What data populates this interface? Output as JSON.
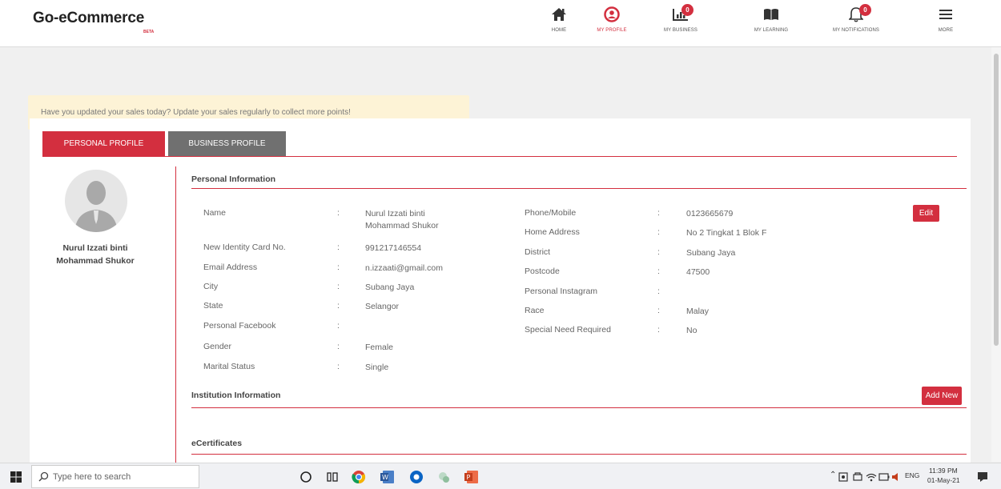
{
  "brand": {
    "title": "Go-eCommerce",
    "beta": "BETA"
  },
  "nav": [
    {
      "label": "HOME",
      "icon": "home-icon"
    },
    {
      "label": "MY PROFILE",
      "icon": "user-icon",
      "active": true
    },
    {
      "label": "MY BUSINESS",
      "icon": "chart-icon",
      "badge": "0"
    },
    {
      "label": "MY LEARNING",
      "icon": "book-icon"
    },
    {
      "label": "MY NOTIFICATIONS",
      "icon": "bell-icon",
      "badge": "0"
    },
    {
      "label": "MORE",
      "icon": "menu-icon"
    }
  ],
  "banner": "Have you updated your sales today? Update your sales regularly to collect more points!",
  "tabs": {
    "personal": "PERSONAL PROFILE",
    "business": "BUSINESS PROFILE"
  },
  "profile": {
    "name": "Nurul Izzati binti Mohammad Shukor"
  },
  "personal_info": {
    "title": "Personal Information",
    "left": [
      {
        "label": "Name",
        "value": "Nurul Izzati binti Mohammad Shukor"
      },
      {
        "label": "New Identity Card No.",
        "value": "991217146554"
      },
      {
        "label": "Email Address",
        "value": "n.izzaati@gmail.com"
      },
      {
        "label": "City",
        "value": "Subang Jaya"
      },
      {
        "label": "State",
        "value": "Selangor"
      },
      {
        "label": "Personal Facebook",
        "value": ""
      },
      {
        "label": "Gender",
        "value": "Female"
      },
      {
        "label": "Marital Status",
        "value": "Single"
      }
    ],
    "right": [
      {
        "label": "Phone/Mobile",
        "value": "0123665679"
      },
      {
        "label": "Home Address",
        "value": "No 2 Tingkat 1 Blok F"
      },
      {
        "label": "District",
        "value": "Subang Jaya"
      },
      {
        "label": "Postcode",
        "value": "47500"
      },
      {
        "label": "Personal Instagram",
        "value": ""
      },
      {
        "label": "Race",
        "value": "Malay"
      },
      {
        "label": "Special Need Required",
        "value": "No"
      }
    ],
    "separator": ":",
    "edit": "Edit"
  },
  "institution": {
    "title": "Institution Information",
    "add_new": "Add New"
  },
  "ecertificates": {
    "title": "eCertificates"
  },
  "taskbar": {
    "search_placeholder": "Type here to search",
    "lang": "ENG",
    "time": "11:39 PM",
    "date": "01-May-21"
  }
}
